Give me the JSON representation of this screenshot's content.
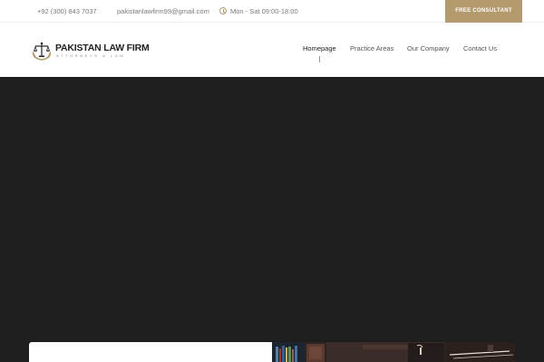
{
  "topbar": {
    "phone": "+92 (300) 843 7037",
    "email": "pakistanlawfirm99@gmail.com",
    "hours": "Mon - Sat 09:00-18:00",
    "separator": "·",
    "cta_label": "FREE CONSULTANT"
  },
  "header": {
    "logo_title": "PAKISTAN LAW FIRM",
    "logo_tagline": "ATTORNEYS & LAW",
    "nav": [
      {
        "label": "Homepage"
      },
      {
        "label": "Practice Areas"
      },
      {
        "label": "Our Company"
      },
      {
        "label": "Contact Us"
      }
    ],
    "active_nav": "Homepage"
  },
  "icons": {
    "hours": "clock-icon",
    "logo": "scales-of-justice-icon"
  },
  "colors": {
    "accent": "#b49b6d",
    "hero_bg": "#1e1e1e",
    "text_muted": "#7a7a7a"
  }
}
